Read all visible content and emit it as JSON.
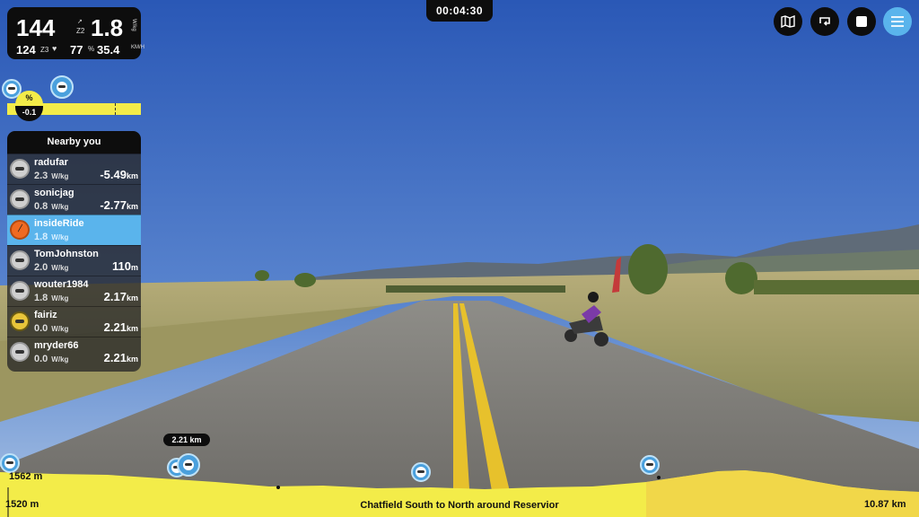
{
  "stats": {
    "speed": "144",
    "speed_zone": "Z2",
    "power_wkg": "1.8",
    "power_unit": "W/kg",
    "heart_rate": "124",
    "hr_zone": "Z3",
    "cadence": "77",
    "distance_speed": "35.4",
    "distance_speed_unit": "KM/H"
  },
  "timer": "00:04:30",
  "toolbar": {
    "map_icon": "map-icon",
    "loop_icon": "loop-icon",
    "stop_icon": "stop-icon",
    "menu_icon": "hamburger-menu-icon"
  },
  "slope": {
    "label": "%",
    "value": "-0.1"
  },
  "nearby": {
    "title": "Nearby you",
    "riders": [
      {
        "name": "radufar",
        "wkg": "2.3",
        "unit": "W/kg",
        "dist": "-5.49",
        "dist_unit": "km",
        "me": false,
        "avatar": "gray"
      },
      {
        "name": "sonicjag",
        "wkg": "0.8",
        "unit": "W/kg",
        "dist": "-2.77",
        "dist_unit": "km",
        "me": false,
        "avatar": "gray"
      },
      {
        "name": "insideRide",
        "wkg": "1.8",
        "unit": "W/kg",
        "dist": "",
        "dist_unit": "",
        "me": true,
        "avatar": "orange"
      },
      {
        "name": "TomJohnston",
        "wkg": "2.0",
        "unit": "W/kg",
        "dist": "110",
        "dist_unit": "m",
        "me": false,
        "avatar": "gray"
      },
      {
        "name": "wouter1984",
        "wkg": "1.8",
        "unit": "W/kg",
        "dist": "2.17",
        "dist_unit": "km",
        "me": false,
        "avatar": "gray"
      },
      {
        "name": "fairiz",
        "wkg": "0.0",
        "unit": "W/kg",
        "dist": "2.21",
        "dist_unit": "km",
        "me": false,
        "avatar": "yellow"
      },
      {
        "name": "mryder66",
        "wkg": "0.0",
        "unit": "W/kg",
        "dist": "2.21",
        "dist_unit": "km",
        "me": false,
        "avatar": "gray"
      }
    ]
  },
  "elevation": {
    "marker_distance": "2.21 km",
    "max_elevation": "1562 m",
    "min_elevation": "1520 m",
    "route_name": "Chatfield South to North around Reservior",
    "total_distance": "10.87 km"
  },
  "colors": {
    "accent_blue": "#5ab4ec",
    "elevation_yellow": "#f3ec49",
    "panel_dark": "#0d0d0d"
  }
}
